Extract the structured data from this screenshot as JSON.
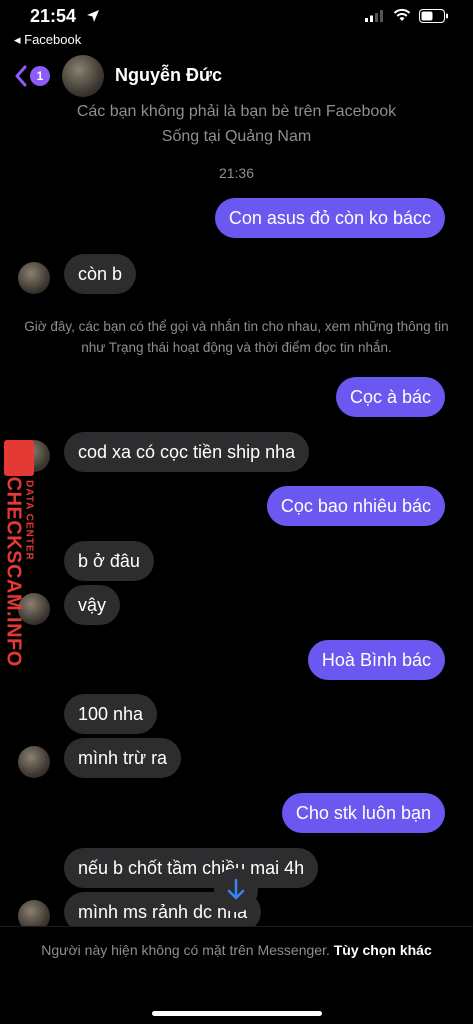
{
  "status_bar": {
    "time": "21:54",
    "back_app": "◂ Facebook"
  },
  "header": {
    "badge": "1",
    "contact_name": "Nguyễn Đức"
  },
  "profile_info": [
    "Các bạn không phải là bạn bè trên Facebook",
    "Sống tại Quảng Nam"
  ],
  "timestamp": "21:36",
  "notice": "Giờ đây, các bạn có thể gọi và nhắn tin cho nhau, xem những thông tin như Trạng thái hoạt động và thời điểm đọc tin nhắn.",
  "messages": {
    "m1": "Con asus đỏ còn ko bácc",
    "m2": "còn b",
    "m3": "Cọc à bác",
    "m4": "cod xa có cọc tiền ship nha",
    "m5": "Cọc bao nhiêu bác",
    "m6": "b ở đâu",
    "m7": "vậy",
    "m8": "Hoà Bình bác",
    "m9": "100 nha",
    "m10": "mình trừ ra",
    "m11": "Cho stk luôn bạn",
    "m12": "nếu b chốt tầm chiều mai 4h",
    "m13": "mình ms rảnh dc nha"
  },
  "watermark": {
    "big": "CHECKSCAM.INFO",
    "small": "DATA CENTER"
  },
  "footer": {
    "status": "Người này hiện không có mặt trên Messenger.",
    "link": "Tùy chọn khác"
  },
  "colors": {
    "sent_bubble": "#6a58f0",
    "received_bubble": "#2d2d2f",
    "accent": "#8b5cf6",
    "watermark": "#e53935"
  }
}
